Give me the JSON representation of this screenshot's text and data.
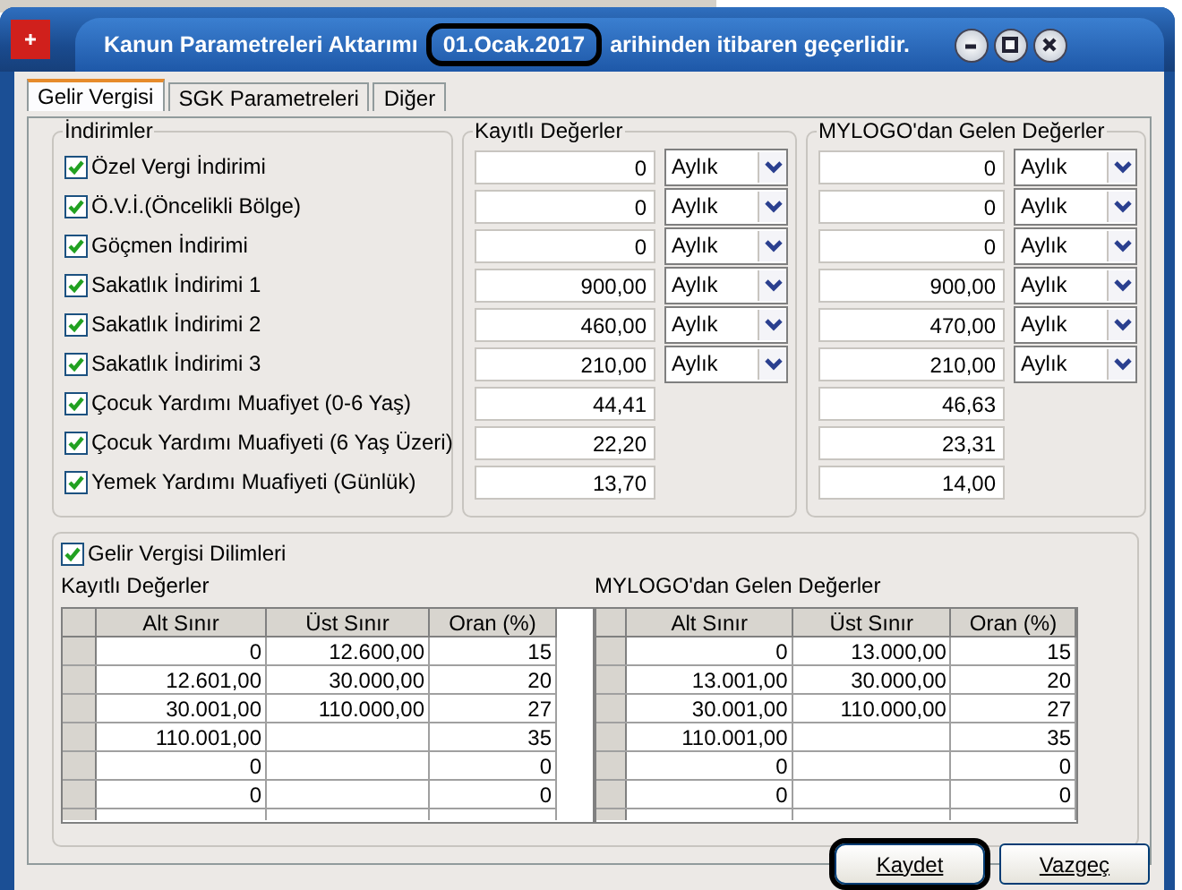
{
  "window": {
    "title": "Kanun Parametreleri Aktarımı",
    "date": "01.Ocak.2017",
    "date_annotated": true,
    "title_suffix": "arihinden itibaren geçerlidir."
  },
  "tabs": [
    {
      "label": "Gelir Vergisi",
      "selected": true
    },
    {
      "label": "SGK Parametreleri",
      "selected": false
    },
    {
      "label": "Diğer",
      "selected": false
    }
  ],
  "deductions": {
    "title": "İndirimler",
    "saved_title": "Kayıtlı Değerler",
    "remote_title": "MYLOGO'dan Gelen Değerler",
    "rows": [
      {
        "label": "Özel Vergi İndirimi",
        "checked": true,
        "saved": "0",
        "saved_period": "Aylık",
        "remote": "0",
        "remote_period": "Aylık"
      },
      {
        "label": "Ö.V.İ.(Öncelikli Bölge)",
        "checked": true,
        "saved": "0",
        "saved_period": "Aylık",
        "remote": "0",
        "remote_period": "Aylık"
      },
      {
        "label": "Göçmen İndirimi",
        "checked": true,
        "saved": "0",
        "saved_period": "Aylık",
        "remote": "0",
        "remote_period": "Aylık"
      },
      {
        "label": "Sakatlık İndirimi 1",
        "checked": true,
        "saved": "900,00",
        "saved_period": "Aylık",
        "remote": "900,00",
        "remote_period": "Aylık"
      },
      {
        "label": "Sakatlık İndirimi 2",
        "checked": true,
        "saved": "460,00",
        "saved_period": "Aylık",
        "remote": "470,00",
        "remote_period": "Aylık"
      },
      {
        "label": "Sakatlık İndirimi 3",
        "checked": true,
        "saved": "210,00",
        "saved_period": "Aylık",
        "remote": "210,00",
        "remote_period": "Aylık"
      },
      {
        "label": "Çocuk Yardımı Muafiyet (0-6 Yaş)",
        "checked": true,
        "saved": "44,41",
        "remote": "46,63"
      },
      {
        "label": "Çocuk Yardımı Muafiyeti (6 Yaş Üzeri)",
        "checked": true,
        "saved": "22,20",
        "remote": "23,31"
      },
      {
        "label": "Yemek Yardımı Muafiyeti (Günlük)",
        "checked": true,
        "saved": "13,70",
        "remote": "14,00"
      }
    ]
  },
  "brackets": {
    "label": "Gelir Vergisi Dilimleri",
    "checked": true,
    "saved": {
      "title": "Kayıtlı Değerler",
      "columns": [
        "Alt Sınır",
        "Üst Sınır",
        "Oran (%)"
      ],
      "rows": [
        [
          "0",
          "12.600,00",
          "15"
        ],
        [
          "12.601,00",
          "30.000,00",
          "20"
        ],
        [
          "30.001,00",
          "110.000,00",
          "27"
        ],
        [
          "110.001,00",
          "",
          "35"
        ],
        [
          "0",
          "",
          "0"
        ],
        [
          "0",
          "",
          "0"
        ]
      ]
    },
    "remote": {
      "title": "MYLOGO'dan Gelen Değerler",
      "columns": [
        "Alt Sınır",
        "Üst Sınır",
        "Oran (%)"
      ],
      "rows": [
        [
          "0",
          "13.000,00",
          "15"
        ],
        [
          "13.001,00",
          "30.000,00",
          "20"
        ],
        [
          "30.001,00",
          "110.000,00",
          "27"
        ],
        [
          "110.001,00",
          "",
          "35"
        ],
        [
          "0",
          "",
          "0"
        ],
        [
          "0",
          "",
          "0"
        ]
      ]
    }
  },
  "buttons": [
    {
      "label": "Kaydet",
      "annotated": true
    },
    {
      "label": "Vazgeç",
      "annotated": false
    }
  ]
}
